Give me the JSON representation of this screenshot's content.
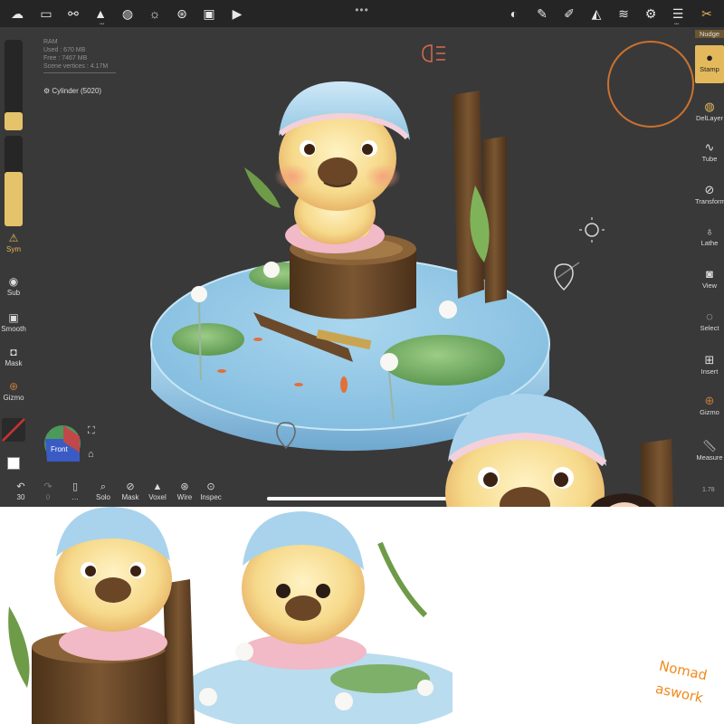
{
  "topbar": {
    "left_icons": [
      "logo-icon",
      "folder-icon",
      "share-icon",
      "scene-icon",
      "globe-icon",
      "sun-icon",
      "film-icon",
      "image-icon",
      "video-icon"
    ],
    "dots": "•••",
    "right_icons": [
      "material-icon",
      "brush-icon",
      "paint-icon",
      "symmetry-icon",
      "layers-icon",
      "settings-icon",
      "sliders-icon",
      "tools-icon"
    ]
  },
  "stats": {
    "heading": "RAM",
    "used": "Used : 670 MB",
    "free": "Free : 7467 MB",
    "vertices": "Scene vertices : 4.17M"
  },
  "object_label": "Cylinder (5020)",
  "left_tools": {
    "sym": "Sym",
    "sub": "Sub",
    "smooth": "Smooth",
    "mask": "Mask",
    "gizmo": "Gizmo"
  },
  "left_sliders": {
    "radius": 0.2,
    "intensity": 0.6
  },
  "right_tools": {
    "nudge": "Nudge",
    "stamp": "Stamp",
    "dellayer": "DelLayer",
    "tube": "Tube",
    "transform": "Transform",
    "lathe": "Lathe",
    "view": "View",
    "select": "Select",
    "insert": "Insert",
    "gizmo": "Gizmo",
    "measure": "Measure"
  },
  "bottom_tools": {
    "undo_count": "30",
    "redo_count": "0",
    "solo": "Solo",
    "mask": "Mask",
    "voxel": "Voxel",
    "wire": "Wire",
    "inspect": "Inspec"
  },
  "view_cube": {
    "label": "Front"
  },
  "version": "1.78",
  "annotation": {
    "line1": "Nomad",
    "line2": "aswork"
  },
  "colors": {
    "accent": "#e3b95c",
    "brush_ring": "#c9722f",
    "viewport_bg": "#3a3939",
    "toolbar_bg": "#252525"
  }
}
